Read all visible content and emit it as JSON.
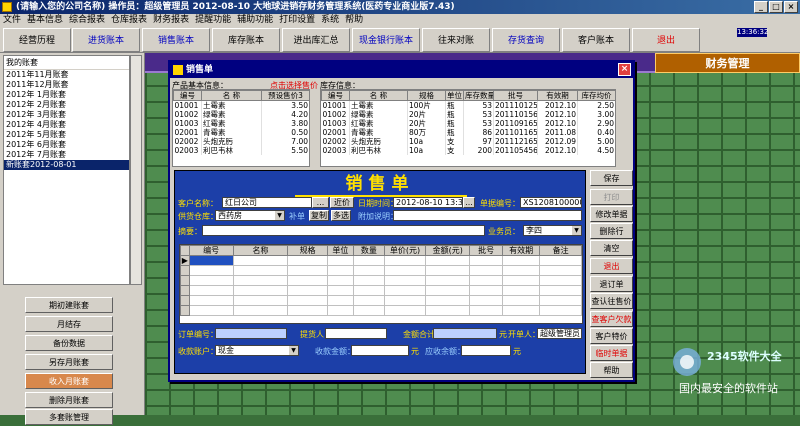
{
  "window": {
    "title": "(请输入您的公司名称)     操作员：超级管理员     2012-08-10     大地球进销存财务管理系统(医药专业商业版7.43)"
  },
  "menu": [
    "文件",
    "基本信息",
    "综合报表",
    "仓库报表",
    "财务报表",
    "提醒功能",
    "辅助功能",
    "打印设置",
    "系统",
    "帮助"
  ],
  "toolbar": [
    {
      "label": "经营历程",
      "style": ""
    },
    {
      "label": "进货账本",
      "style": "blue"
    },
    {
      "label": "销售账本",
      "style": "blue"
    },
    {
      "label": "库存账本",
      "style": ""
    },
    {
      "label": "进出库汇总",
      "style": ""
    },
    {
      "label": "现金银行账本",
      "style": "blue"
    },
    {
      "label": "往来对账",
      "style": ""
    },
    {
      "label": "存货查询",
      "style": "blue"
    },
    {
      "label": "客户账本",
      "style": ""
    },
    {
      "label": "退出",
      "style": "red"
    }
  ],
  "clock": "13:36:32",
  "left": {
    "header": "我的账套",
    "accounts": [
      "2011年11月账套",
      "2011年12月账套",
      "2012年 1月账套",
      "2012年 2月账套",
      "2012年 3月账套",
      "2012年 4月账套",
      "2012年 5月账套",
      "2012年 6月账套",
      "2012年 7月账套",
      "新账套2012-08-01"
    ],
    "selected_index": 9,
    "buttons": [
      {
        "label": "期初建账套",
        "style": ""
      },
      {
        "label": "月结存",
        "style": ""
      },
      {
        "label": "备份数据",
        "style": ""
      },
      {
        "label": "另存月账套",
        "style": ""
      },
      {
        "label": "收入月账套",
        "style": "orange"
      },
      {
        "label": "删除月账套",
        "style": ""
      },
      {
        "label": "多套账管理",
        "style": ""
      }
    ]
  },
  "finance_label": "财务管理",
  "dialog": {
    "title": "销售单",
    "product_section": {
      "label": "产品基本信息：",
      "hint": "点击选择售价",
      "preset": "预设售价3",
      "columns": [
        "编号",
        "名  称",
        "预设售价3"
      ],
      "rows": [
        [
          "01001",
          "土霉素",
          "3.50"
        ],
        [
          "01002",
          "绿霉素",
          "4.20"
        ],
        [
          "01003",
          "红霉素",
          "3.80"
        ],
        [
          "02001",
          "青霉素",
          "0.50"
        ],
        [
          "02002",
          "头炮克肟",
          "7.00"
        ],
        [
          "02003",
          "利巴韦林",
          "5.50"
        ]
      ]
    },
    "stock_section": {
      "label": "库存信息：",
      "columns": [
        "编号",
        "名  称",
        "规格",
        "单位",
        "库存数量",
        "批号",
        "有效期",
        "库存均价"
      ],
      "rows": [
        [
          "01001",
          "土霉素",
          "100片",
          "瓶",
          "53",
          "201110125",
          "2012.10",
          "2.50"
        ],
        [
          "01002",
          "绿霉素",
          "20片",
          "瓶",
          "53",
          "201110156",
          "2012.10",
          "3.00"
        ],
        [
          "01003",
          "红霉素",
          "20片",
          "瓶",
          "53",
          "201109165",
          "2012.10",
          "2.90"
        ],
        [
          "02001",
          "青霉素",
          "80万",
          "瓶",
          "86",
          "201101165",
          "2011.08",
          "0.40"
        ],
        [
          "02002",
          "头炮克肟",
          "10a",
          "支",
          "97",
          "201112165",
          "2012.09",
          "5.00"
        ],
        [
          "02003",
          "利巴韦林",
          "10a",
          "支",
          "200",
          "201105456",
          "2012.10",
          "4.50"
        ]
      ]
    },
    "form": {
      "title": "销售单",
      "customer_label": "客户名称：",
      "customer_value": "红日公司",
      "customer_btn": "...",
      "price_btn": "近价",
      "date_label": "日期时间：",
      "date_value": "2012-08-10 13:36:32",
      "date_btn": "...",
      "bill_label": "单据编号：",
      "bill_value": "XS120810000012",
      "warehouse_label": "供货仓库：",
      "warehouse_value": "西药房",
      "links": [
        "补单",
        "复制",
        "多选"
      ],
      "note_label": "附加说明：",
      "summary_label": "摘要：",
      "salesman_label": "业务员：",
      "salesman_value": "李四",
      "columns": [
        "编号",
        "名称",
        "规格",
        "单位",
        "数量",
        "单价(元)",
        "金额(元)",
        "批号",
        "有效期",
        "备注"
      ],
      "order_label": "订单编号：",
      "proposer_label": "提货人",
      "amount_label": "金额合计",
      "amount_unit": "元",
      "operator_label": "开单人：",
      "operator_value": "超级管理员",
      "account_label": "收款账户：",
      "account_value": "现金",
      "received_label": "收款金额：",
      "received_unit": "元",
      "due_label": "应收余额：",
      "due_unit": "元"
    },
    "actions": [
      {
        "label": "保存",
        "style": ""
      },
      {
        "label": "打印",
        "style": "dis"
      },
      {
        "label": "修改单据",
        "style": ""
      },
      {
        "label": "删除行",
        "style": ""
      },
      {
        "label": "清空",
        "style": ""
      },
      {
        "label": "退出",
        "style": "red"
      },
      {
        "label": "退订单",
        "style": ""
      },
      {
        "label": "查认往售价",
        "style": ""
      },
      {
        "label": "查客户欠款",
        "style": "red"
      },
      {
        "label": "客户特价",
        "style": ""
      },
      {
        "label": "临时单据",
        "style": "red"
      },
      {
        "label": "帮助",
        "style": ""
      }
    ]
  },
  "watermark": {
    "line1": "2345软件大全",
    "line2": "国内最安全的软件站"
  }
}
